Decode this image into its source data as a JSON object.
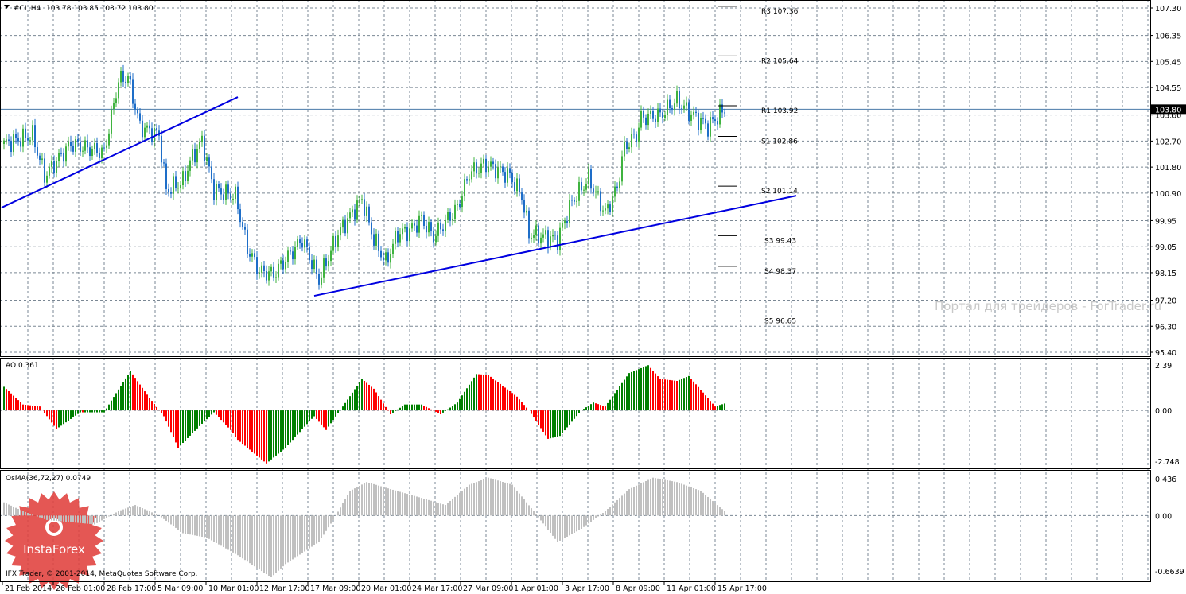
{
  "header": {
    "symbol": "#CL,H4",
    "ohlc": "103.78 103.85 103.72 103.80"
  },
  "colors": {
    "bull": "#3fb33f",
    "bear": "#1e6ec8",
    "trend": "#0000e0",
    "grid": "#7a8794",
    "ao_up": "#008000",
    "ao_down": "#ff0000",
    "osma": "#c0c0c0",
    "price_line": "#4a7aa8"
  },
  "price_axis": {
    "ticks": [
      "107.30",
      "106.35",
      "105.45",
      "104.55",
      "103.60",
      "102.70",
      "101.80",
      "100.90",
      "99.95",
      "99.05",
      "98.15",
      "97.20",
      "96.30",
      "95.40"
    ],
    "current": "103.80",
    "range": [
      95.4,
      107.3
    ]
  },
  "pivots": [
    {
      "label": "R3 107.36",
      "value": 107.36
    },
    {
      "label": "R2 105.64",
      "value": 105.64
    },
    {
      "label": "R1 103.92",
      "value": 103.92
    },
    {
      "label": "S1 102.86",
      "value": 102.86
    },
    {
      "label": "S2 101.14",
      "value": 101.14
    },
    {
      "label": "S3 99.43",
      "value": 99.43
    },
    {
      "label": "S4 98.37",
      "value": 98.37
    },
    {
      "label": "S5 96.65",
      "value": 96.65
    }
  ],
  "price_anchors": [
    [
      0,
      102.6
    ],
    [
      12,
      102.9
    ],
    [
      17,
      101.5
    ],
    [
      28,
      102.6
    ],
    [
      42,
      102.3
    ],
    [
      48,
      104.8
    ],
    [
      52,
      104.9
    ],
    [
      57,
      103.2
    ],
    [
      65,
      102.9
    ],
    [
      68,
      101.0
    ],
    [
      75,
      101.3
    ],
    [
      78,
      102.0
    ],
    [
      83,
      102.7
    ],
    [
      88,
      101.0
    ],
    [
      97,
      100.8
    ],
    [
      102,
      99.0
    ],
    [
      107,
      98.2
    ],
    [
      113,
      98.1
    ],
    [
      125,
      99.3
    ],
    [
      132,
      97.9
    ],
    [
      137,
      98.9
    ],
    [
      140,
      99.5
    ],
    [
      145,
      100.1
    ],
    [
      150,
      100.7
    ],
    [
      155,
      99.3
    ],
    [
      160,
      98.5
    ],
    [
      165,
      99.5
    ],
    [
      170,
      99.6
    ],
    [
      175,
      100.0
    ],
    [
      180,
      99.4
    ],
    [
      190,
      100.4
    ],
    [
      195,
      101.6
    ],
    [
      202,
      101.9
    ],
    [
      212,
      101.5
    ],
    [
      217,
      100.8
    ],
    [
      220,
      99.5
    ],
    [
      232,
      99.3
    ],
    [
      238,
      100.6
    ],
    [
      245,
      101.4
    ],
    [
      252,
      100.2
    ],
    [
      257,
      101.1
    ],
    [
      260,
      102.5
    ],
    [
      265,
      102.9
    ],
    [
      267,
      103.5
    ],
    [
      275,
      103.6
    ],
    [
      282,
      104.1
    ],
    [
      287,
      103.7
    ],
    [
      295,
      103.2
    ],
    [
      302,
      103.8
    ]
  ],
  "trendlines": [
    [
      [
        -1,
        100.4
      ],
      [
        98,
        104.22
      ]
    ],
    [
      [
        130,
        97.35
      ],
      [
        332,
        100.81
      ]
    ]
  ],
  "ao": {
    "label": "AO 0.361",
    "ticks": [
      "2.39",
      "0.00",
      "-2.748"
    ],
    "range": [
      -2.748,
      2.39
    ],
    "anchors": [
      [
        0,
        1.2
      ],
      [
        8,
        0.3
      ],
      [
        15,
        0.2
      ],
      [
        22,
        -0.95
      ],
      [
        32,
        -0.1
      ],
      [
        42,
        -0.1
      ],
      [
        45,
        0.5
      ],
      [
        53,
        2.0
      ],
      [
        60,
        0.8
      ],
      [
        67,
        -0.3
      ],
      [
        73,
        -1.9
      ],
      [
        82,
        -0.8
      ],
      [
        88,
        -0.1
      ],
      [
        95,
        -1.0
      ],
      [
        98,
        -1.5
      ],
      [
        110,
        -2.7
      ],
      [
        118,
        -1.9
      ],
      [
        130,
        -0.3
      ],
      [
        135,
        -1.0
      ],
      [
        142,
        0.2
      ],
      [
        150,
        1.6
      ],
      [
        155,
        1.1
      ],
      [
        162,
        -0.2
      ],
      [
        168,
        0.3
      ],
      [
        175,
        0.3
      ],
      [
        183,
        -0.2
      ],
      [
        190,
        0.4
      ],
      [
        198,
        1.85
      ],
      [
        203,
        1.8
      ],
      [
        215,
        0.7
      ],
      [
        220,
        0
      ],
      [
        228,
        -1.45
      ],
      [
        233,
        -1.3
      ],
      [
        242,
        0
      ],
      [
        247,
        0.4
      ],
      [
        252,
        0.2
      ],
      [
        262,
        1.9
      ],
      [
        270,
        2.3
      ],
      [
        275,
        1.6
      ],
      [
        282,
        1.5
      ],
      [
        287,
        1.75
      ],
      [
        298,
        0.2
      ],
      [
        302,
        0.35
      ]
    ]
  },
  "osma": {
    "label": "OsMA(36,72,27) 0.0749",
    "ticks": [
      "0.436",
      "0.00",
      "-0.6639"
    ],
    "range": [
      -0.6639,
      0.436
    ],
    "anchors": [
      [
        0,
        0.15
      ],
      [
        8,
        0.05
      ],
      [
        18,
        -0.05
      ],
      [
        38,
        -0.1
      ],
      [
        48,
        0.05
      ],
      [
        55,
        0.12
      ],
      [
        65,
        0
      ],
      [
        75,
        -0.2
      ],
      [
        85,
        -0.25
      ],
      [
        98,
        -0.45
      ],
      [
        112,
        -0.7
      ],
      [
        118,
        -0.55
      ],
      [
        132,
        -0.3
      ],
      [
        138,
        -0.05
      ],
      [
        145,
        0.28
      ],
      [
        152,
        0.38
      ],
      [
        162,
        0.3
      ],
      [
        175,
        0.2
      ],
      [
        185,
        0.12
      ],
      [
        195,
        0.35
      ],
      [
        203,
        0.43
      ],
      [
        213,
        0.35
      ],
      [
        222,
        0.05
      ],
      [
        232,
        -0.3
      ],
      [
        242,
        -0.15
      ],
      [
        252,
        0.05
      ],
      [
        262,
        0.3
      ],
      [
        272,
        0.43
      ],
      [
        282,
        0.38
      ],
      [
        292,
        0.28
      ],
      [
        302,
        0.05
      ]
    ]
  },
  "time_axis": [
    "21 Feb 2014",
    "26 Feb 01:00",
    "28 Feb 17:00",
    "5 Mar 09:00",
    "10 Mar 01:00",
    "12 Mar 17:00",
    "17 Mar 09:00",
    "20 Mar 01:00",
    "24 Mar 17:00",
    "27 Mar 09:00",
    "1 Apr 01:00",
    "3 Apr 17:00",
    "8 Apr 09:00",
    "11 Apr 01:00",
    "15 Apr 17:00"
  ],
  "watermark": "Портал для трейдеров - ForTrader.ru",
  "badge": "InstaForex",
  "copyright": "IFX Trader, © 2001-2014, MetaQuotes Software Corp."
}
